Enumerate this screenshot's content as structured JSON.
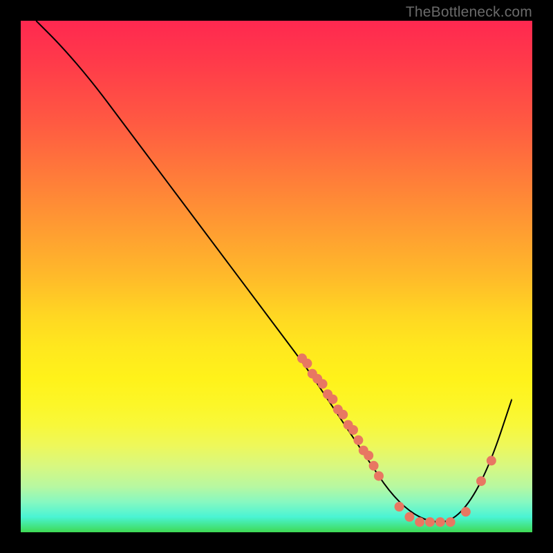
{
  "watermark": "TheBottleneck.com",
  "chart_data": {
    "type": "line",
    "title": "",
    "xlabel": "",
    "ylabel": "",
    "xlim": [
      0,
      100
    ],
    "ylim": [
      0,
      100
    ],
    "grid": false,
    "legend": false,
    "series": [
      {
        "name": "curve",
        "x": [
          3,
          8,
          14,
          20,
          26,
          32,
          38,
          44,
          50,
          56,
          60,
          64,
          68,
          72,
          76,
          80,
          84,
          88,
          92,
          96
        ],
        "y": [
          100,
          95,
          88,
          80,
          72,
          64,
          56,
          48,
          40,
          32,
          26,
          20,
          14,
          8,
          4,
          2,
          2,
          6,
          14,
          26
        ]
      }
    ],
    "scatter_points": [
      {
        "x": 55,
        "y": 34
      },
      {
        "x": 56,
        "y": 33
      },
      {
        "x": 57,
        "y": 31
      },
      {
        "x": 58,
        "y": 30
      },
      {
        "x": 59,
        "y": 29
      },
      {
        "x": 60,
        "y": 27
      },
      {
        "x": 61,
        "y": 26
      },
      {
        "x": 62,
        "y": 24
      },
      {
        "x": 63,
        "y": 23
      },
      {
        "x": 64,
        "y": 21
      },
      {
        "x": 65,
        "y": 20
      },
      {
        "x": 66,
        "y": 18
      },
      {
        "x": 67,
        "y": 16
      },
      {
        "x": 68,
        "y": 15
      },
      {
        "x": 69,
        "y": 13
      },
      {
        "x": 70,
        "y": 11
      },
      {
        "x": 74,
        "y": 5
      },
      {
        "x": 76,
        "y": 3
      },
      {
        "x": 78,
        "y": 2
      },
      {
        "x": 80,
        "y": 2
      },
      {
        "x": 82,
        "y": 2
      },
      {
        "x": 84,
        "y": 2
      },
      {
        "x": 87,
        "y": 4
      },
      {
        "x": 90,
        "y": 10
      },
      {
        "x": 92,
        "y": 14
      }
    ]
  }
}
